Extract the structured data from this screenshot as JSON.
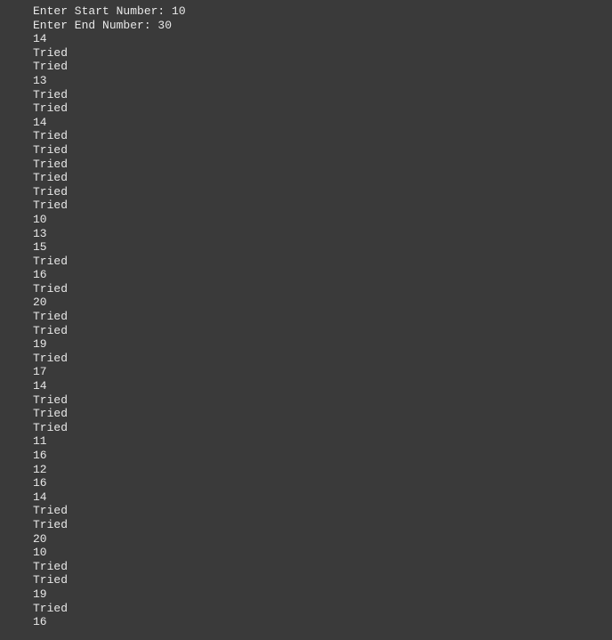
{
  "console": {
    "lines": [
      "Enter Start Number: 10",
      "Enter End Number: 30",
      "14",
      "Tried",
      "Tried",
      "13",
      "Tried",
      "Tried",
      "14",
      "Tried",
      "Tried",
      "Tried",
      "Tried",
      "Tried",
      "Tried",
      "10",
      "13",
      "15",
      "Tried",
      "16",
      "Tried",
      "20",
      "Tried",
      "Tried",
      "19",
      "Tried",
      "17",
      "14",
      "Tried",
      "Tried",
      "Tried",
      "11",
      "16",
      "12",
      "16",
      "14",
      "Tried",
      "Tried",
      "20",
      "10",
      "Tried",
      "Tried",
      "19",
      "Tried",
      "16"
    ]
  }
}
